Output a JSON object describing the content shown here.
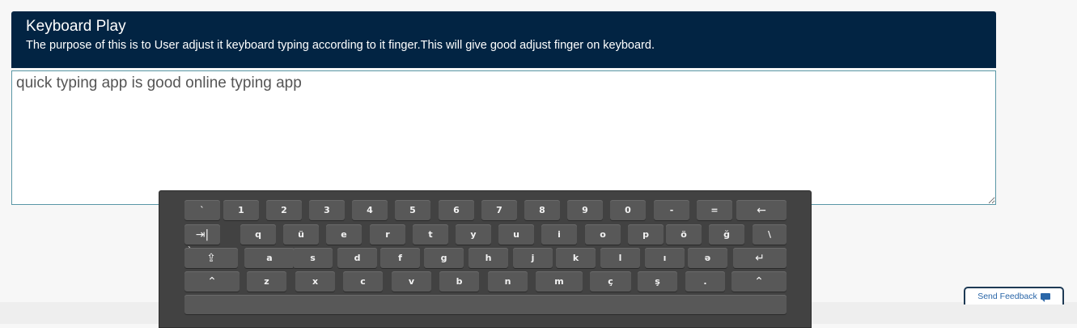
{
  "header": {
    "title": "Keyboard Play",
    "description": "The purpose of this is to User adjust it keyboard typing according to it finger.This will give good adjust finger on keyboard."
  },
  "typing_area": {
    "value": "quick typing app is good online typing app"
  },
  "keyboard": {
    "rows": [
      [
        "`",
        "1",
        "2",
        "3",
        "4",
        "5",
        "6",
        "7",
        "8",
        "9",
        "0",
        "-",
        "=",
        "←"
      ],
      [
        "⇥|",
        "q",
        "ü",
        "e",
        "r",
        "t",
        "y",
        "u",
        "i",
        "o",
        "p",
        "ö",
        "ğ",
        "\\"
      ],
      [
        "⇪",
        "a",
        "s",
        "d",
        "f",
        "g",
        "h",
        "j",
        "k",
        "l",
        "ı",
        "ə",
        "↵"
      ],
      [
        "⌃",
        "z",
        "x",
        "c",
        "v",
        "b",
        "n",
        "m",
        "ç",
        "ş",
        ".",
        "⌃"
      ],
      [
        ""
      ]
    ],
    "caps_tick": "`"
  },
  "feedback": {
    "label": "Send Feedback",
    "icon": "chat-bubble-icon"
  },
  "colors": {
    "header_bg": "#022443",
    "keyboard_bg": "#424242",
    "key_bg": "#585858",
    "feedback_text": "#2a66a8"
  }
}
